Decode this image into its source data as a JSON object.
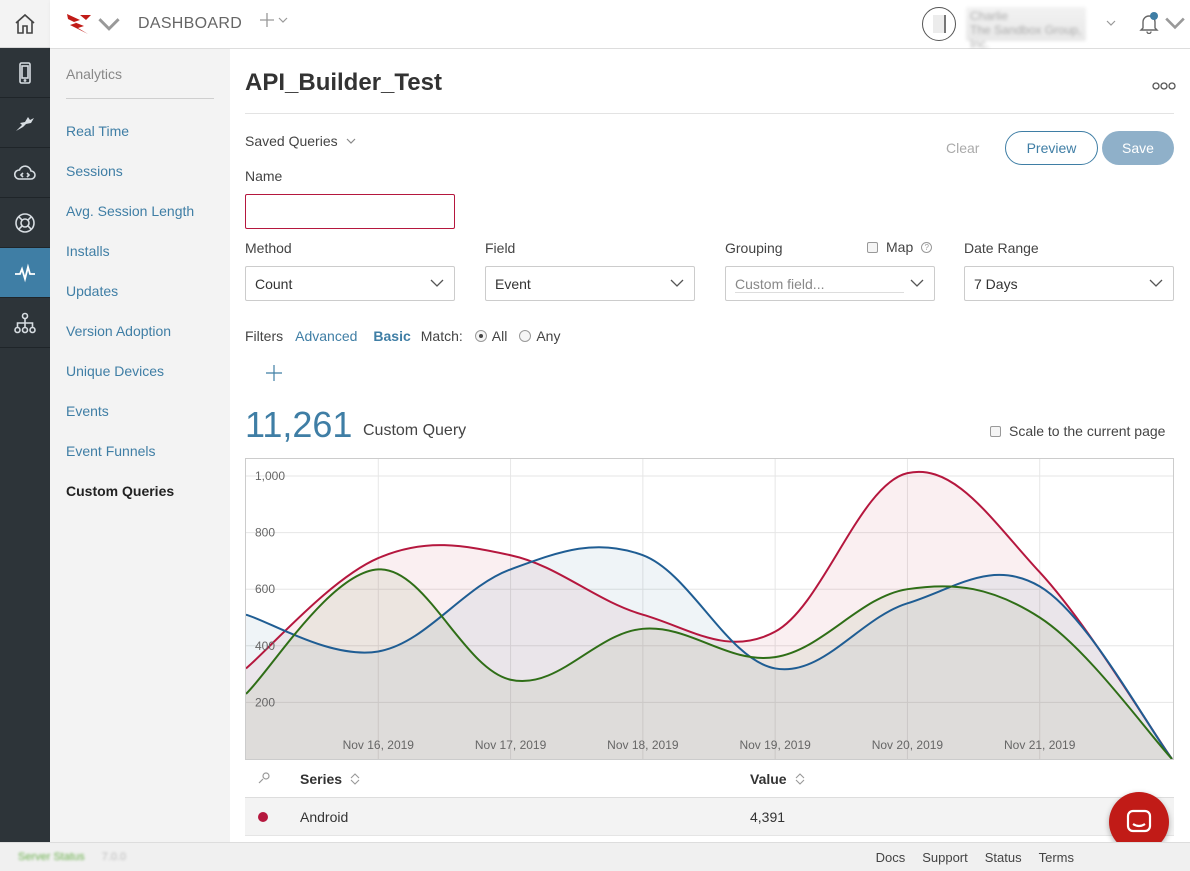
{
  "topbar": {
    "dashboard_label": "DASHBOARD",
    "user_name": "Charlie",
    "user_org": "The Sandbox Group, Inc."
  },
  "rail": {
    "items": [
      {
        "icon": "home-icon"
      },
      {
        "icon": "mobile-icon"
      },
      {
        "icon": "hummingbird-icon"
      },
      {
        "icon": "cloud-code-icon"
      },
      {
        "icon": "lifebuoy-icon"
      },
      {
        "icon": "pulse-icon",
        "active": true
      },
      {
        "icon": "network-icon"
      }
    ]
  },
  "sidebar": {
    "title": "Analytics",
    "items": [
      {
        "label": "Real Time"
      },
      {
        "label": "Sessions"
      },
      {
        "label": "Avg. Session Length"
      },
      {
        "label": "Installs"
      },
      {
        "label": "Updates"
      },
      {
        "label": "Version Adoption"
      },
      {
        "label": "Unique Devices"
      },
      {
        "label": "Events"
      },
      {
        "label": "Event Funnels"
      },
      {
        "label": "Custom Queries",
        "current": true
      }
    ]
  },
  "main": {
    "title": "API_Builder_Test",
    "more_label": "ooo",
    "saved_queries_label": "Saved Queries",
    "clear_label": "Clear",
    "preview_label": "Preview",
    "save_label": "Save",
    "name_label": "Name",
    "name_value": "",
    "method": {
      "label": "Method",
      "value": "Count"
    },
    "field": {
      "label": "Field",
      "value": "Event"
    },
    "grouping": {
      "label": "Grouping",
      "placeholder": "Custom field..."
    },
    "map_label": "Map",
    "date_range": {
      "label": "Date Range",
      "value": "7 Days"
    },
    "filters": {
      "label": "Filters",
      "advanced": "Advanced",
      "basic": "Basic",
      "match": "Match:",
      "all": "All",
      "any": "Any",
      "selected": "All"
    },
    "total_value": "11,261",
    "total_label": "Custom Query",
    "scale_label": "Scale to the current page"
  },
  "chart_data": {
    "type": "area",
    "x": [
      "Nov 15, 2019",
      "Nov 16, 2019",
      "Nov 17, 2019",
      "Nov 18, 2019",
      "Nov 19, 2019",
      "Nov 20, 2019",
      "Nov 21, 2019",
      "Nov 22, 2019"
    ],
    "x_tick_labels": [
      "Nov 16, 2019",
      "Nov 17, 2019",
      "Nov 18, 2019",
      "Nov 19, 2019",
      "Nov 20, 2019",
      "Nov 21, 2019"
    ],
    "y_tick_labels": [
      "200",
      "400",
      "600",
      "800",
      "1,000"
    ],
    "ylim": [
      0,
      1060
    ],
    "grid": true,
    "series": [
      {
        "color": "#b5173e",
        "values": [
          320,
          710,
          720,
          510,
          450,
          1010,
          660,
          0
        ]
      },
      {
        "color": "#1f5d93",
        "values": [
          510,
          380,
          670,
          720,
          320,
          550,
          610,
          0
        ]
      },
      {
        "color": "#2f6e17",
        "values": [
          230,
          670,
          280,
          460,
          360,
          600,
          500,
          0
        ]
      }
    ]
  },
  "table": {
    "columns": [
      "Series",
      "Value"
    ],
    "rows": [
      {
        "series": "Android",
        "value": "4,391",
        "color": "#b5173e"
      }
    ]
  },
  "footer": {
    "status": "Server Status",
    "version": "7.0.0",
    "links": [
      "Docs",
      "Support",
      "Status",
      "Terms"
    ]
  }
}
